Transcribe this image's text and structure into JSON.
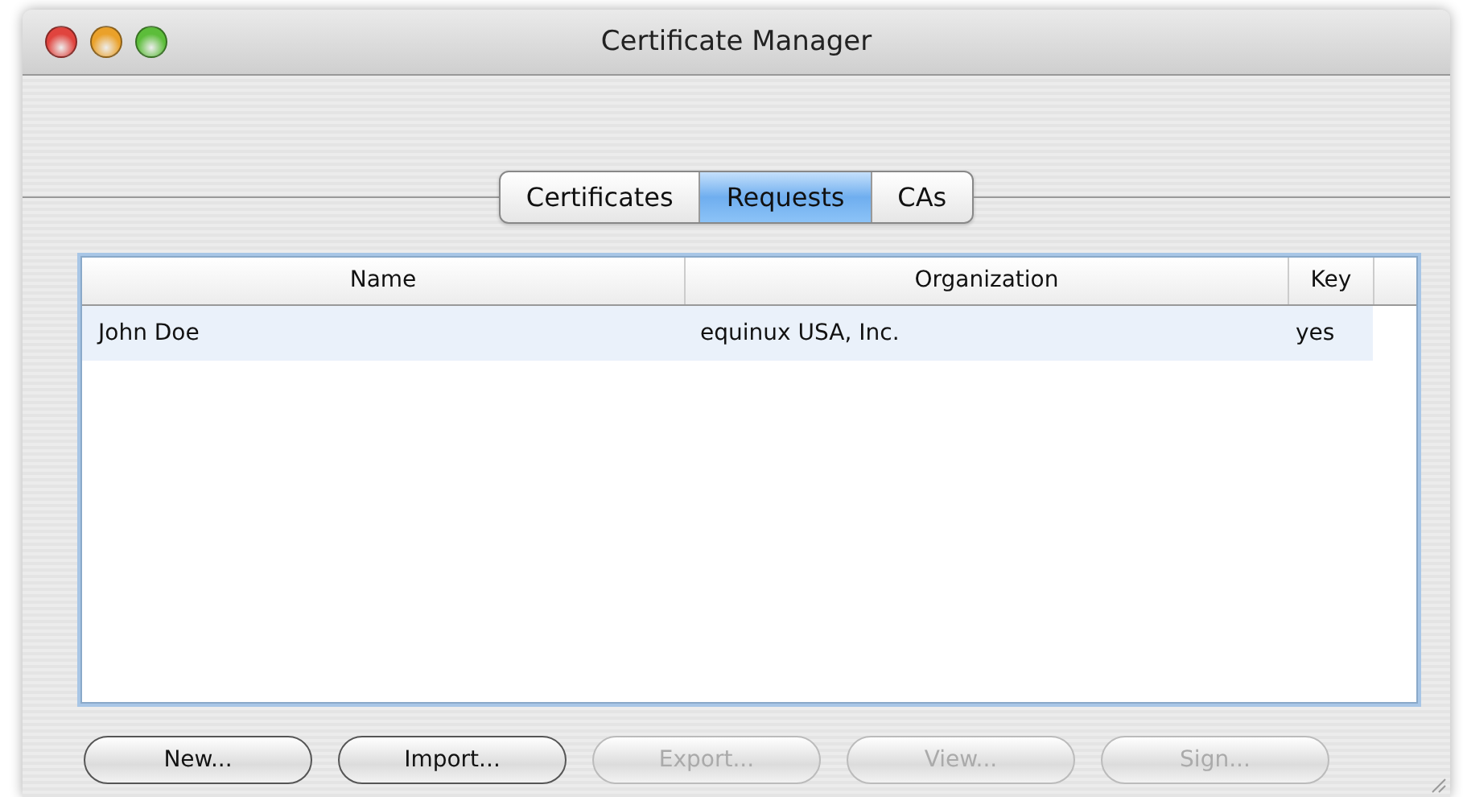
{
  "window": {
    "title": "Certificate Manager"
  },
  "tabs": [
    {
      "label": "Certificates",
      "selected": false
    },
    {
      "label": "Requests",
      "selected": true
    },
    {
      "label": "CAs",
      "selected": false
    }
  ],
  "table": {
    "columns": [
      "Name",
      "Organization",
      "Key"
    ],
    "rows": [
      {
        "cells": [
          "John Doe",
          "equinux USA, Inc.",
          "yes"
        ],
        "selected": true
      }
    ]
  },
  "buttons": [
    {
      "label": "New...",
      "disabled": false
    },
    {
      "label": "Import...",
      "disabled": false
    },
    {
      "label": "Export...",
      "disabled": true
    },
    {
      "label": "View...",
      "disabled": true
    },
    {
      "label": "Sign...",
      "disabled": true
    }
  ]
}
